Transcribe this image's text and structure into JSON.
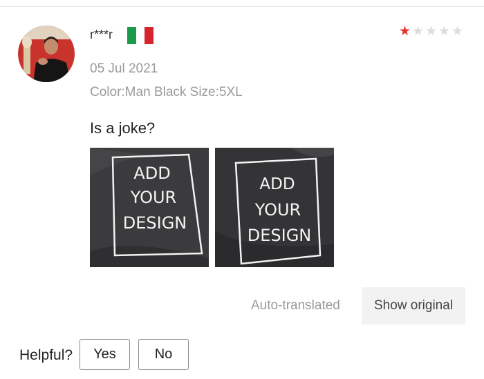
{
  "review": {
    "username": "r***r",
    "country_flag_colors": [
      "#1a9a4a",
      "#ffffff",
      "#d4242d"
    ],
    "rating": 1,
    "rating_max": 5,
    "star_filled_color": "#e8322b",
    "star_empty_color": "#dddddd",
    "date": "05 Jul 2021",
    "sku": "Color:Man Black Size:5XL",
    "text": "Is a joke?",
    "photos": [
      {
        "lines": [
          "ADD",
          "YOUR",
          "DESIGN"
        ]
      },
      {
        "lines": [
          "ADD",
          "YOUR",
          "DESIGN"
        ]
      }
    ]
  },
  "translation": {
    "status": "Auto-translated",
    "show_original_label": "Show original"
  },
  "feedback": {
    "prompt": "Helpful?",
    "yes_label": "Yes",
    "no_label": "No"
  }
}
